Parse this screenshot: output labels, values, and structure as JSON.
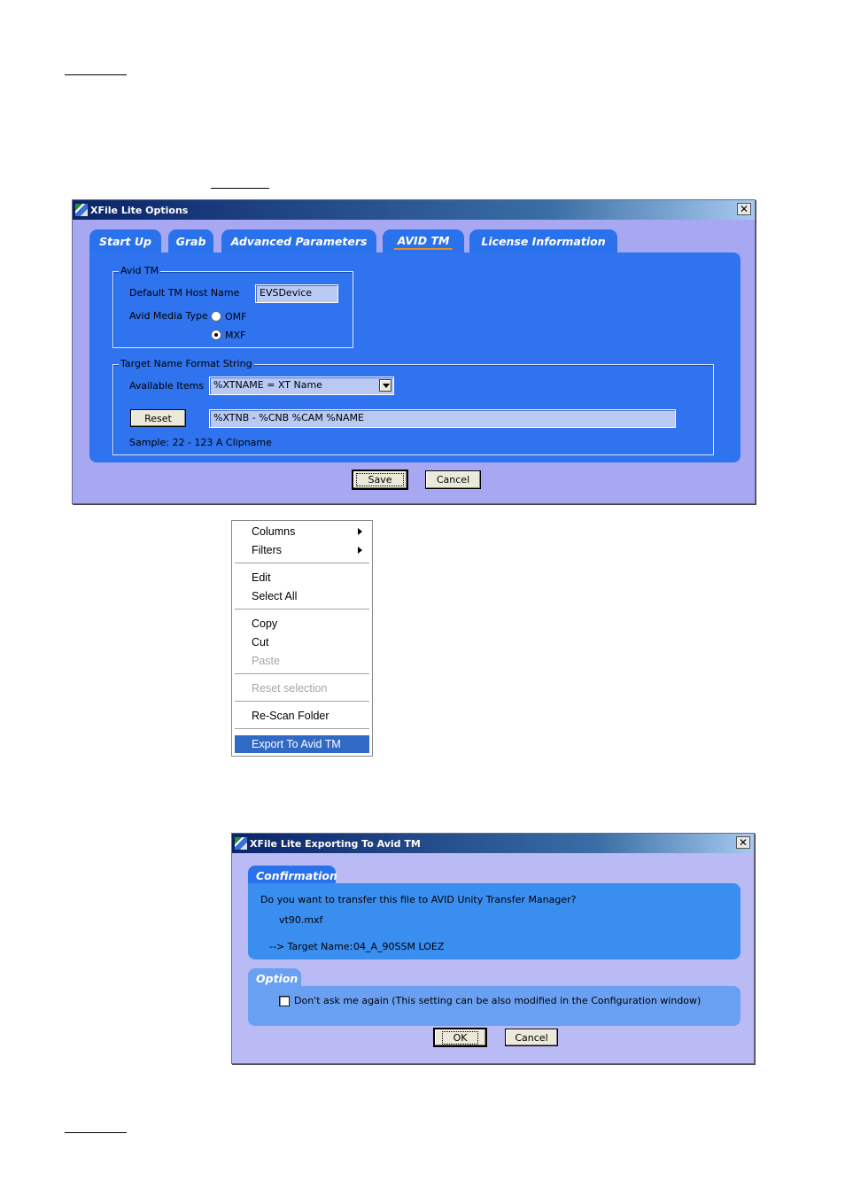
{
  "options_window": {
    "title": "XFile Lite Options",
    "tabs": [
      "Start Up",
      "Grab",
      "Advanced Parameters",
      "AVID TM",
      "License Information"
    ],
    "active_tab": "AVID TM",
    "avid_group": {
      "legend": "Avid TM",
      "host_label": "Default TM Host Name",
      "host_value": "EVSDevice",
      "media_type_label": "Avid Media Type",
      "omf_label": "OMF",
      "mxf_label": "MXF",
      "selected_media_type": "MXF"
    },
    "format_group": {
      "legend": "Target Name Format String",
      "available_label": "Available Items",
      "available_value": "%XTNAME   = XT Name",
      "reset_label": "Reset",
      "format_value": "%XTNB - %CNB %CAM %NAME",
      "sample_text": "Sample: 22 - 123 A Clipname"
    },
    "save_label": "Save",
    "cancel_label": "Cancel"
  },
  "context_menu": {
    "items": [
      {
        "label": "Columns",
        "submenu": true
      },
      {
        "label": "Filters",
        "submenu": true
      },
      {
        "label": "Edit"
      },
      {
        "label": "Select All"
      },
      {
        "label": "Copy"
      },
      {
        "label": "Cut"
      },
      {
        "label": "Paste",
        "disabled": true
      },
      {
        "label": "Reset selection",
        "disabled": true
      },
      {
        "label": "Re-Scan Folder"
      },
      {
        "label": "Export To Avid TM",
        "selected": true
      }
    ]
  },
  "export_dialog": {
    "title": "XFile Lite Exporting To Avid TM",
    "confirmation_title": "Confirmation",
    "question": "Do you want to transfer this file to AVID Unity Transfer Manager?",
    "file_name": "vt90.mxf",
    "target_label": "--> Target Name:",
    "target_value": "04_A_90SSM LOEZ",
    "option_title": "Option",
    "dont_ask_label": "Don't ask me again (This setting can be also modified in the Configuration window)",
    "dont_ask_checked": false,
    "ok_label": "OK",
    "cancel_label": "Cancel"
  },
  "colors": {
    "window_bg": "#a7a7f2",
    "tab_blue": "#2a72ec",
    "panel_blue": "#2f73ee",
    "menu_highlight": "#316ac5",
    "active_tab_underline": "#e68a2e"
  }
}
